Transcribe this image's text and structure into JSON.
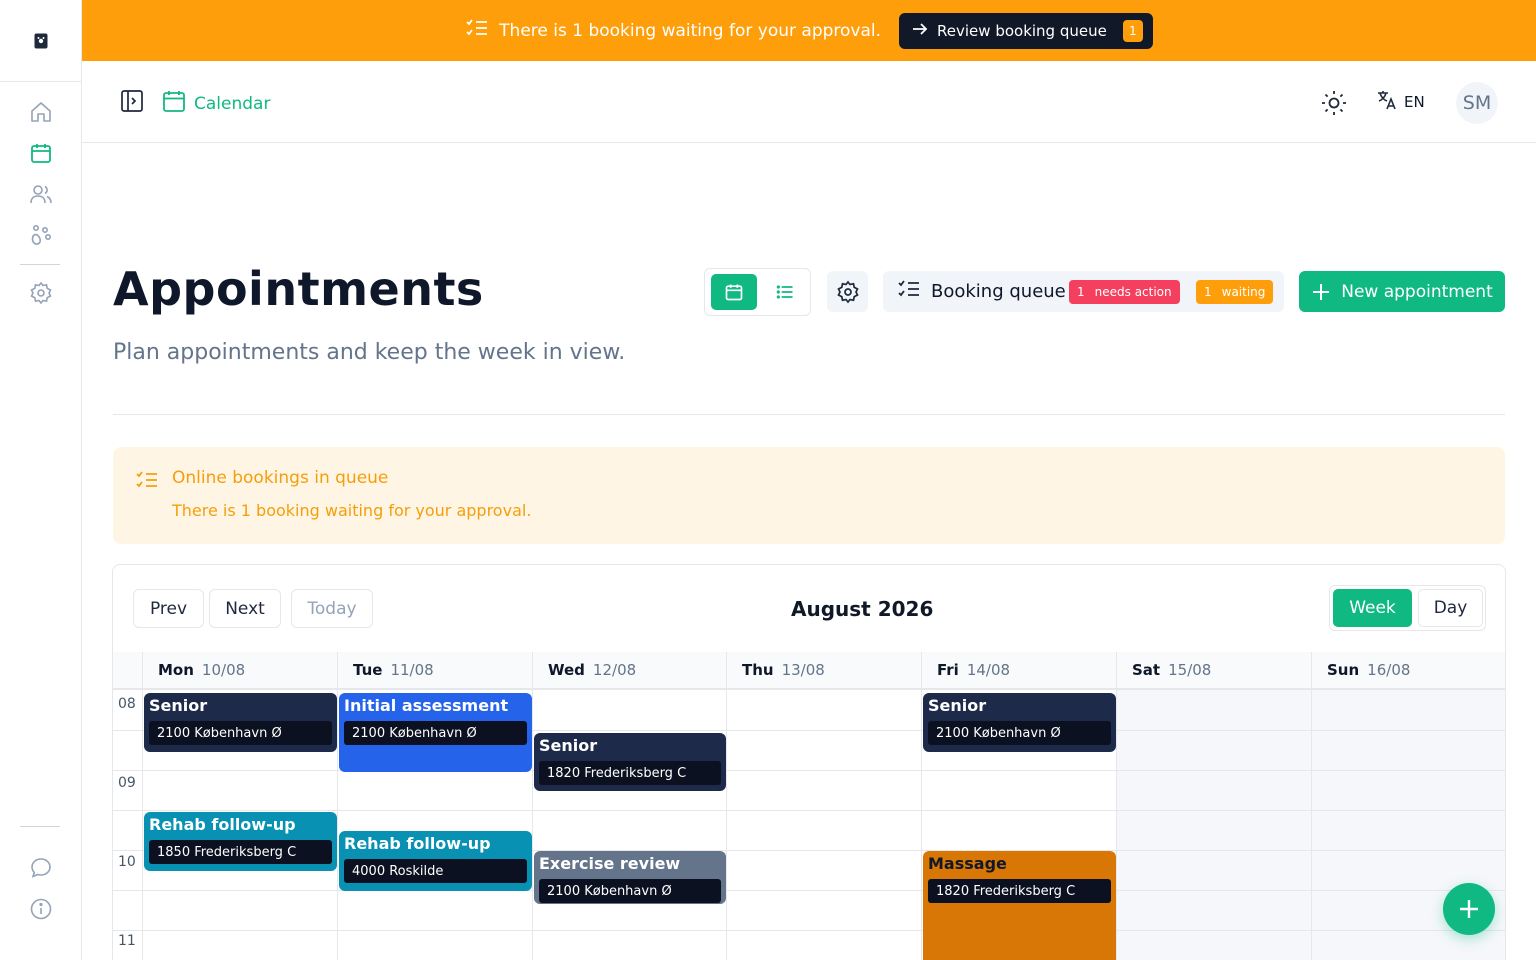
{
  "colors": {
    "accent": "#10b981",
    "warning": "#ff9e0b",
    "danger": "#f43f5e"
  },
  "banner": {
    "message": "There is 1 booking waiting for your approval.",
    "button_label": "Review booking queue",
    "count": "1"
  },
  "header": {
    "breadcrumb": "Calendar",
    "language": "EN",
    "avatar_initials": "SM"
  },
  "page": {
    "title": "Appointments",
    "subtitle": "Plan appointments and keep the week in view.",
    "queue_label": "Booking queue",
    "needs_action_count": "1",
    "needs_action_label": "needs action",
    "waiting_count": "1",
    "waiting_label": "waiting",
    "new_appointment_label": "New appointment"
  },
  "alert": {
    "title": "Online bookings in queue",
    "body": "There is 1 booking waiting for your approval."
  },
  "calendar": {
    "prev": "Prev",
    "next": "Next",
    "today": "Today",
    "month": "August 2026",
    "view_week": "Week",
    "view_day": "Day",
    "days": [
      {
        "name": "Mon",
        "date": "10/08"
      },
      {
        "name": "Tue",
        "date": "11/08"
      },
      {
        "name": "Wed",
        "date": "12/08"
      },
      {
        "name": "Thu",
        "date": "13/08"
      },
      {
        "name": "Fri",
        "date": "14/08"
      },
      {
        "name": "Sat",
        "date": "15/08"
      },
      {
        "name": "Sun",
        "date": "16/08"
      }
    ],
    "hours": [
      "08",
      "09",
      "10",
      "11"
    ],
    "events": [
      {
        "title": "Senior",
        "location": "2100 København Ø",
        "color": "navy"
      },
      {
        "title": "Initial assessment",
        "location": "2100 København Ø",
        "color": "blue"
      },
      {
        "title": "Senior",
        "location": "1820 Frederiksberg C",
        "color": "navy"
      },
      {
        "title": "Senior",
        "location": "2100 København Ø",
        "color": "navy"
      },
      {
        "title": "Rehab follow-up",
        "location": "1850 Frederiksberg C",
        "color": "teal"
      },
      {
        "title": "Rehab follow-up",
        "location": "4000 Roskilde",
        "color": "teal"
      },
      {
        "title": "Exercise review",
        "location": "2100 København Ø",
        "color": "slate"
      },
      {
        "title": "Massage",
        "location": "1820 Frederiksberg C",
        "color": "amber"
      }
    ]
  },
  "icons": {
    "logo": "paw-logo-icon",
    "nav": [
      "home-icon",
      "calendar-icon",
      "users-icon",
      "paw-icon",
      "settings-icon",
      "chat-icon",
      "info-icon"
    ]
  }
}
